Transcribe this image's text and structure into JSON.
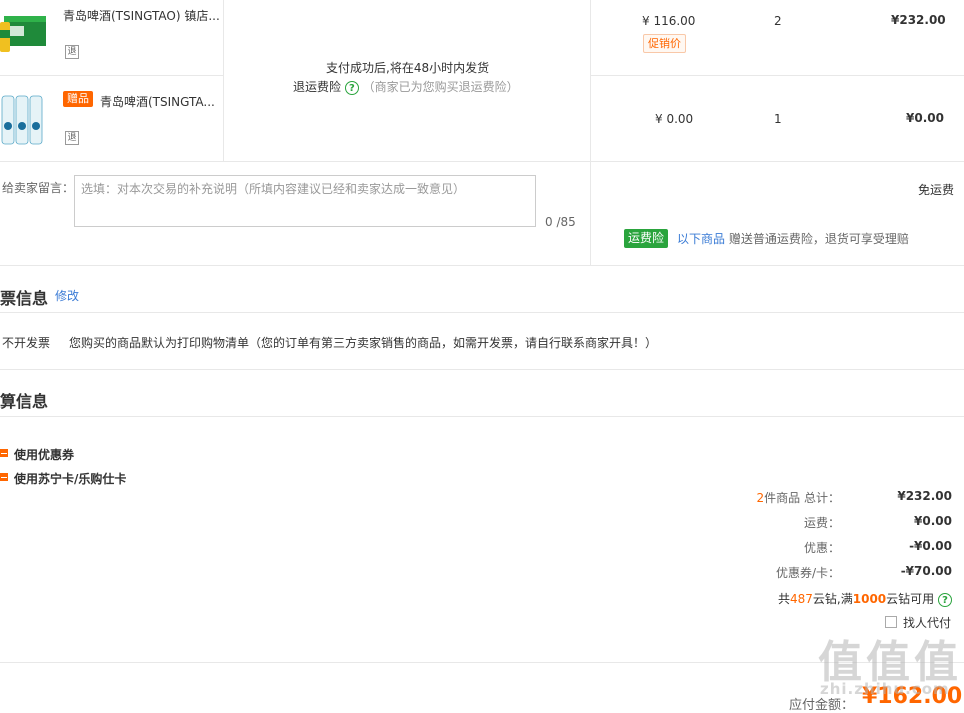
{
  "items": [
    {
      "name": "青岛啤酒(TSINGTAO) 镇店...",
      "refund_icon": "退",
      "unit_price": "¥ 116.00",
      "promo_label": "促销价",
      "qty": "2",
      "subtotal": "¥232.00"
    },
    {
      "gift_label": "赠品",
      "name": "青岛啤酒(TSINGTA...",
      "refund_icon": "退",
      "unit_price": "¥ 0.00",
      "qty": "1",
      "subtotal": "¥0.00"
    }
  ],
  "shipping": {
    "ship_note": "支付成功后,将在48小时内发货",
    "insurance_label": "退运费险",
    "insurance_note": "（商家已为您购买退运费险）",
    "help_icon": "?"
  },
  "message": {
    "label": "给卖家留言：",
    "placeholder": "选填：对本次交易的补充说明（所填内容建议已经和卖家达成一致意见）",
    "counter": "0 /85"
  },
  "freight": {
    "free_label": "免运费",
    "tag": "运费险",
    "link": "以下商品",
    "note": "赠送普通运费险，退货可享受理赔"
  },
  "invoice": {
    "title": "票信息",
    "edit_link": "修改",
    "type": "不开发票",
    "desc": "您购买的商品默认为打印购物清单（您的订单有第三方卖家销售的商品，如需开发票，请自行联系商家开具！）"
  },
  "settlement": {
    "title": "算信息",
    "coupon_option": "使用优惠券",
    "card_option": "使用苏宁卡/乐购仕卡"
  },
  "summary": {
    "count": "2",
    "count_suffix": "件商品 总计：",
    "total": "¥232.00",
    "freight_label": "运费：",
    "freight": "¥0.00",
    "discount_label": "优惠：",
    "discount": "-¥0.00",
    "coupon_label": "优惠券/卡：",
    "coupon": "-¥70.00",
    "diamond_prefix": "共",
    "diamond_count": "487",
    "diamond_mid": "云钻,满",
    "diamond_threshold": "1000",
    "diamond_suffix": "云钻可用",
    "pay_for_me": "找人代付",
    "payable_label": "应付金额：",
    "payable": "¥162.00"
  },
  "watermark": {
    "logo": "值",
    "site": "zhi.zhihu.com"
  },
  "colors": {
    "accent": "#ff6600",
    "green": "#2aa43d",
    "link": "#3a7bd5"
  }
}
